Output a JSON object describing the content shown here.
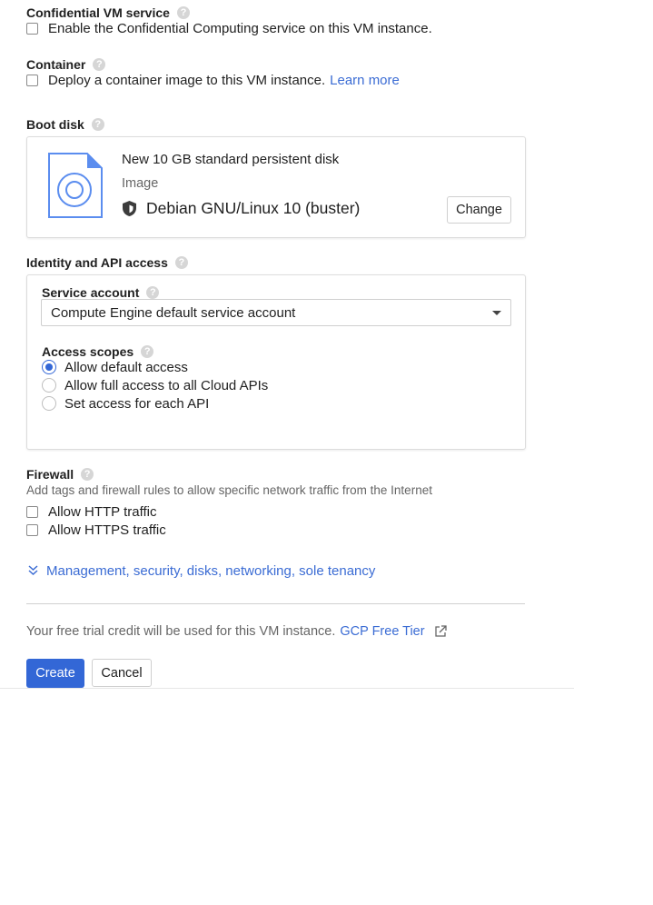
{
  "confidential": {
    "title": "Confidential VM service",
    "checkbox_label": "Enable the Confidential Computing service on this VM instance."
  },
  "container": {
    "title": "Container",
    "checkbox_label": "Deploy a container image to this VM instance.",
    "learn_more": "Learn more"
  },
  "boot_disk": {
    "title": "Boot disk",
    "disk_name": "New 10 GB standard persistent disk",
    "image_label": "Image",
    "image_value": "Debian GNU/Linux 10 (buster)",
    "change_button": "Change"
  },
  "identity": {
    "title": "Identity and API access",
    "service_account_label": "Service account",
    "service_account_value": "Compute Engine default service account",
    "access_scopes_label": "Access scopes",
    "scopes": [
      {
        "label": "Allow default access",
        "checked": true
      },
      {
        "label": "Allow full access to all Cloud APIs",
        "checked": false
      },
      {
        "label": "Set access for each API",
        "checked": false
      }
    ]
  },
  "firewall": {
    "title": "Firewall",
    "description": "Add tags and firewall rules to allow specific network traffic from the Internet",
    "http_label": "Allow HTTP traffic",
    "https_label": "Allow HTTPS traffic"
  },
  "management_link": "Management, security, disks, networking, sole tenancy",
  "trial": {
    "text": "Your free trial credit will be used for this VM instance.",
    "link": "GCP Free Tier"
  },
  "actions": {
    "create": "Create",
    "cancel": "Cancel"
  },
  "colors": {
    "accent": "#3367d6",
    "link": "#3b6cd4",
    "disk_icon": "#5b8def"
  }
}
